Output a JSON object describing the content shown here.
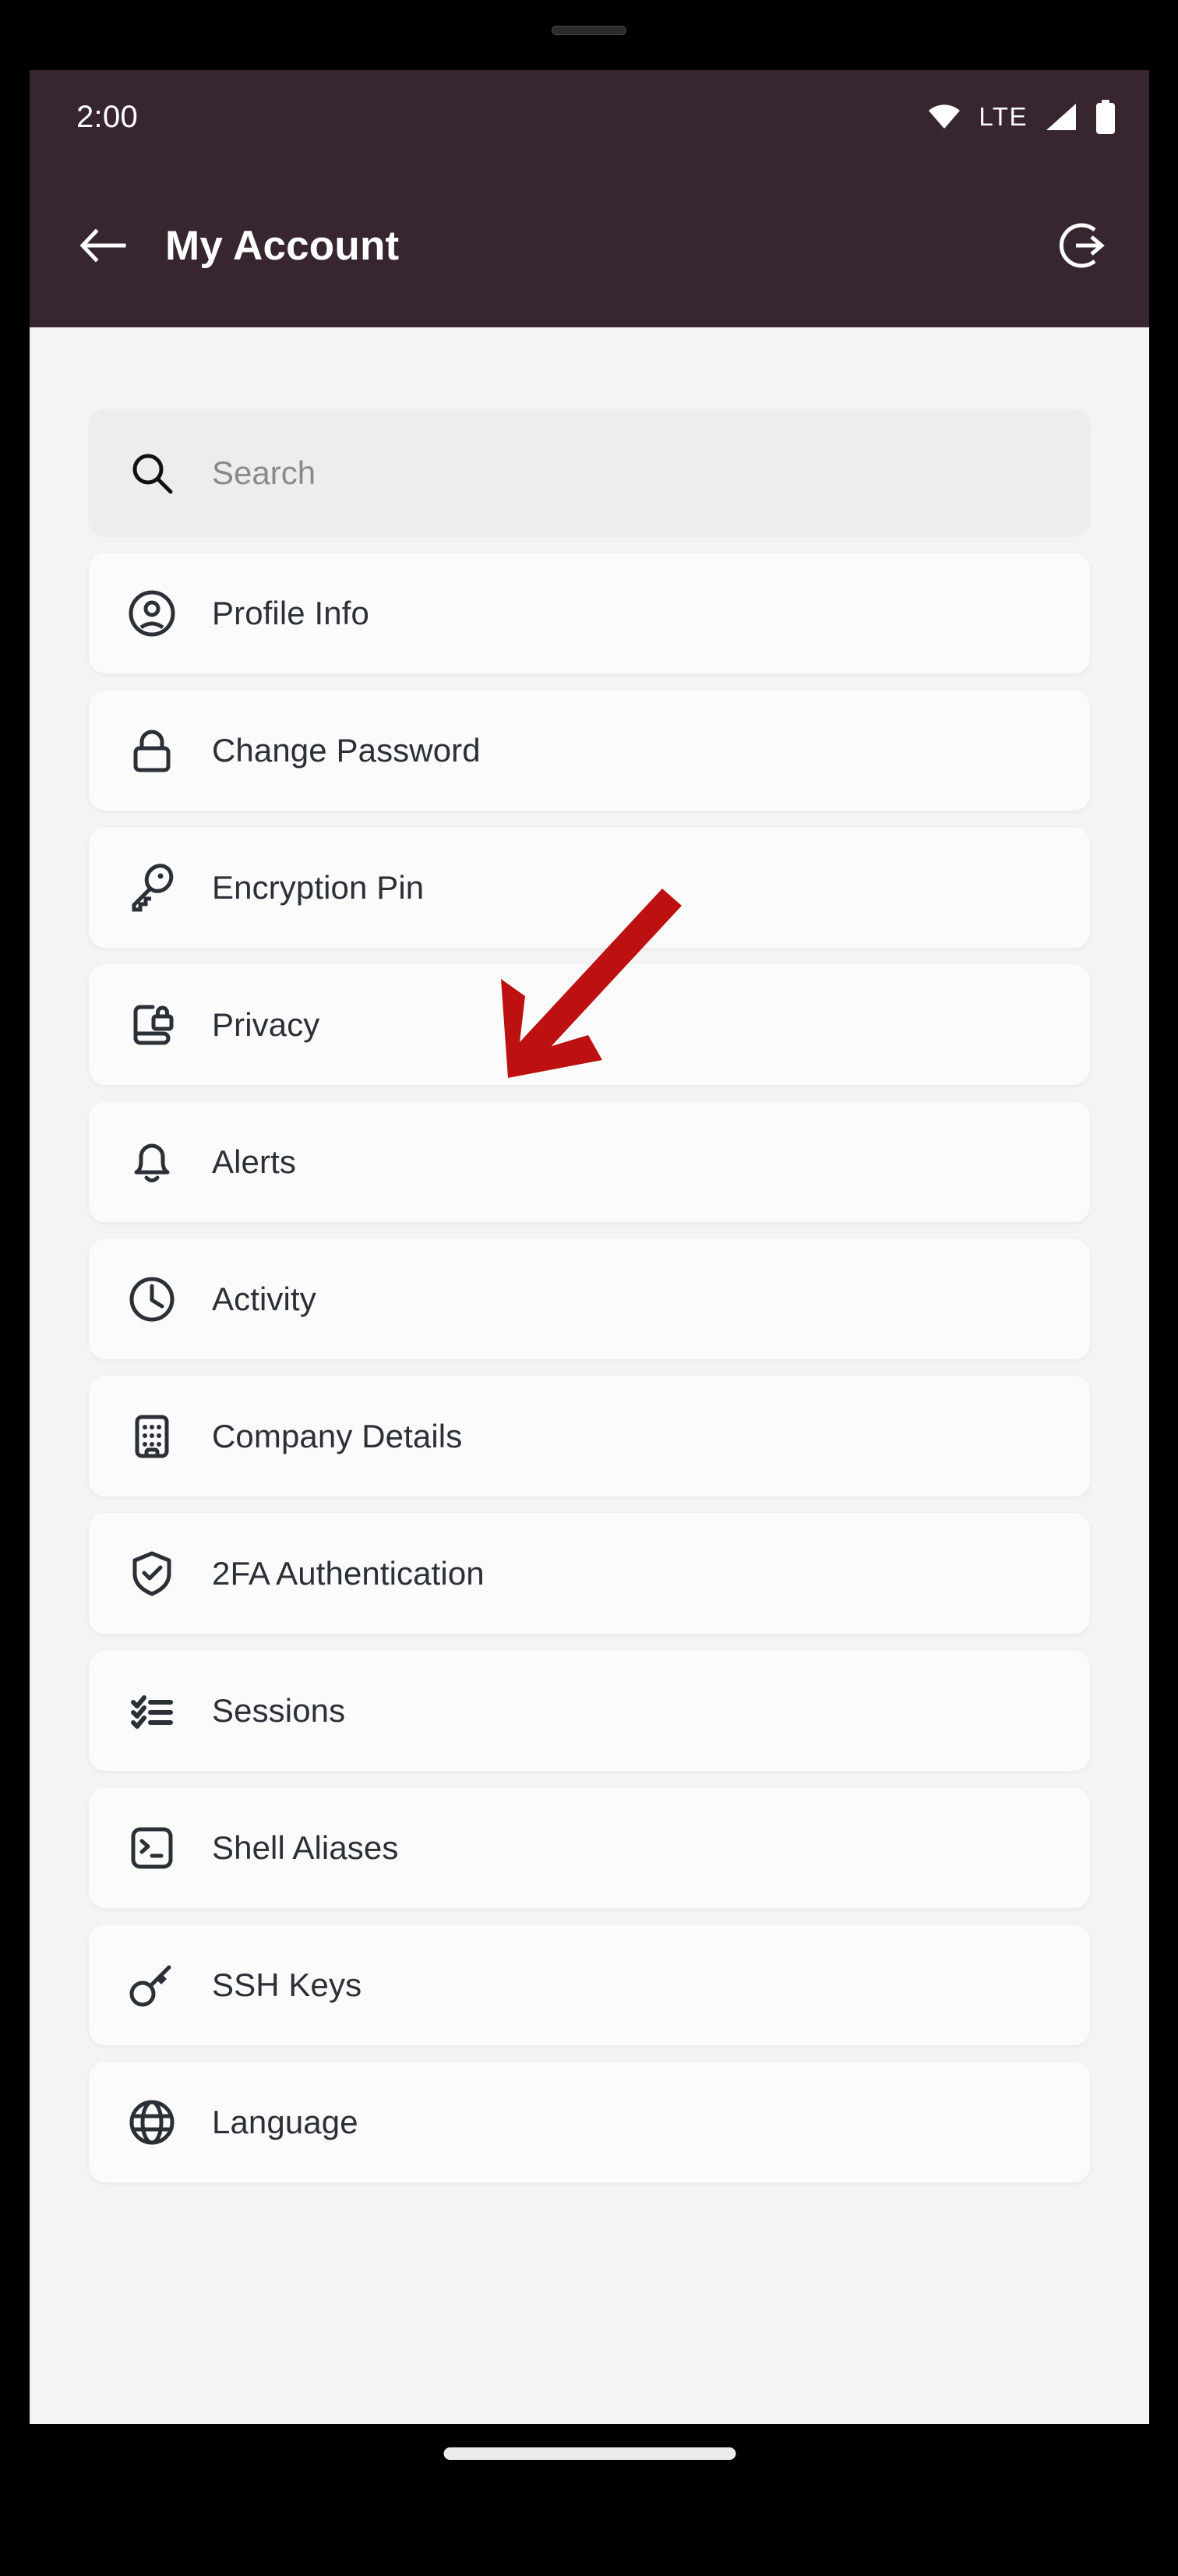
{
  "status_bar": {
    "time": "2:00",
    "network_label": "LTE",
    "icons": [
      "wifi-icon",
      "signal-icon",
      "battery-icon"
    ]
  },
  "app_bar": {
    "title": "My Account",
    "back_icon": "arrow-left-icon",
    "logout_icon": "logout-icon"
  },
  "search": {
    "placeholder": "Search",
    "value": "",
    "icon": "search-icon"
  },
  "menu": {
    "items": [
      {
        "label": "Profile Info",
        "icon": "user-circle-icon"
      },
      {
        "label": "Change Password",
        "icon": "lock-icon"
      },
      {
        "label": "Encryption Pin",
        "icon": "key-icon"
      },
      {
        "label": "Privacy",
        "icon": "document-lock-icon"
      },
      {
        "label": "Alerts",
        "icon": "bell-icon"
      },
      {
        "label": "Activity",
        "icon": "clock-icon"
      },
      {
        "label": "Company Details",
        "icon": "building-icon"
      },
      {
        "label": "2FA Authentication",
        "icon": "shield-check-icon"
      },
      {
        "label": "Sessions",
        "icon": "checklist-icon"
      },
      {
        "label": "Shell Aliases",
        "icon": "terminal-icon"
      },
      {
        "label": "SSH Keys",
        "icon": "key-round-icon"
      },
      {
        "label": "Language",
        "icon": "globe-icon"
      }
    ]
  },
  "annotation": {
    "type": "arrow",
    "color": "#bd1111",
    "points_to": "Encryption Pin"
  },
  "colors": {
    "app_bar": "#37252f",
    "page_background": "#f5f4f4",
    "card_background": "#fbfbfb",
    "text_primary": "#2b2f36",
    "text_placeholder": "#8a8a8a",
    "annotation_red": "#bd1111"
  }
}
